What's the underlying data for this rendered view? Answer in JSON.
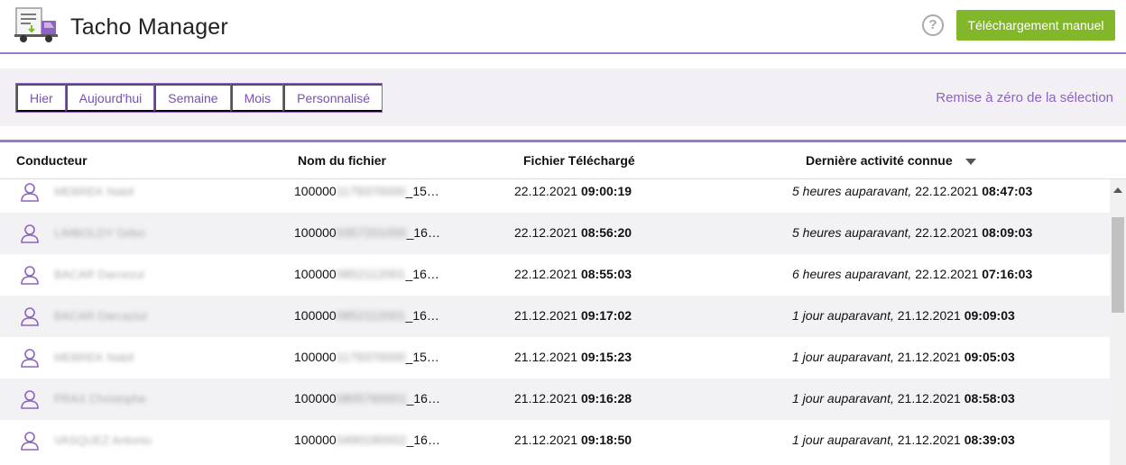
{
  "header": {
    "app_title": "Tacho Manager",
    "help_label": "?",
    "manual_download_label": "Téléchargement manuel"
  },
  "filters": {
    "periods": [
      {
        "label": "Hier"
      },
      {
        "label": "Aujourd'hui"
      },
      {
        "label": "Semaine"
      },
      {
        "label": "Mois"
      },
      {
        "label": "Personnalisé"
      }
    ],
    "reset_label": "Remise à zéro de la sélection"
  },
  "table": {
    "columns": {
      "driver": "Conducteur",
      "file": "Nom du fichier",
      "downloaded": "Fichier Téléchargé",
      "last_activity": "Dernière activité connue"
    },
    "sort_column": "last_activity",
    "sort_direction": "descending",
    "rows": [
      {
        "driver": "MEBREK Nabil",
        "file_prefix": "100000",
        "file_hidden": "1179370000",
        "file_suffix": "_15…",
        "dl_date": "22.12.2021",
        "dl_time": "09:00:19",
        "act_rel": "5 heures auparavant,",
        "act_date": "22.12.2021",
        "act_time": "08:47:03"
      },
      {
        "driver": "LIMBOLDY Gébo",
        "file_prefix": "100000",
        "file_hidden": "0357201055",
        "file_suffix": "_16…",
        "dl_date": "22.12.2021",
        "dl_time": "08:56:20",
        "act_rel": "5 heures auparavant,",
        "act_date": "22.12.2021",
        "act_time": "08:09:03"
      },
      {
        "driver": "BACAR Darcezul",
        "file_prefix": "100000",
        "file_hidden": "0852112001",
        "file_suffix": "_16…",
        "dl_date": "22.12.2021",
        "dl_time": "08:55:03",
        "act_rel": "6 heures auparavant,",
        "act_date": "22.12.2021",
        "act_time": "07:16:03"
      },
      {
        "driver": "BACAR Darcaziul",
        "file_prefix": "100000",
        "file_hidden": "0852112001",
        "file_suffix": "_16…",
        "dl_date": "21.12.2021",
        "dl_time": "09:17:02",
        "act_rel": "1 jour auparavant,",
        "act_date": "21.12.2021",
        "act_time": "09:09:03"
      },
      {
        "driver": "MEBREK Nabil",
        "file_prefix": "100000",
        "file_hidden": "1179370000",
        "file_suffix": "_15…",
        "dl_date": "21.12.2021",
        "dl_time": "09:15:23",
        "act_rel": "1 jour auparavant,",
        "act_date": "21.12.2021",
        "act_time": "09:05:03"
      },
      {
        "driver": "PRAX Christophe",
        "file_prefix": "100000",
        "file_hidden": "0805760001",
        "file_suffix": "_16…",
        "dl_date": "21.12.2021",
        "dl_time": "09:16:28",
        "act_rel": "1 jour auparavant,",
        "act_date": "21.12.2021",
        "act_time": "08:58:03"
      },
      {
        "driver": "VASQUEZ Antonio",
        "file_prefix": "100000",
        "file_hidden": "0490180002",
        "file_suffix": "_16…",
        "dl_date": "21.12.2021",
        "dl_time": "09:18:50",
        "act_rel": "1 jour auparavant,",
        "act_date": "21.12.2021",
        "act_time": "08:39:03"
      }
    ]
  },
  "colors": {
    "accent_purple": "#8e62c0",
    "header_rule": "#9b7cc4",
    "button_green": "#82b72a",
    "filterbar_bg": "#f2f0f5",
    "row_alt_bg": "#f2f1f4"
  },
  "icons": {
    "logo": "truck-download-icon",
    "help": "help-circle-icon",
    "sort": "sort-desc-icon",
    "row": "user-icon",
    "scroll": "scroll-up-arrow-icon"
  }
}
